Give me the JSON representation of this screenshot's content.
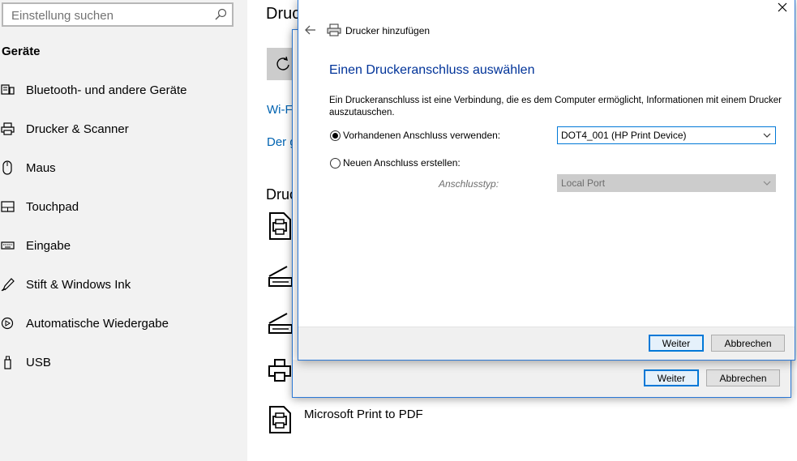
{
  "sidebar": {
    "search_placeholder": "Einstellung suchen",
    "heading": "Geräte",
    "items": [
      {
        "label": "Bluetooth- und andere Geräte",
        "icon": "bluetooth-devices-icon"
      },
      {
        "label": "Drucker & Scanner",
        "icon": "printer-icon"
      },
      {
        "label": "Maus",
        "icon": "mouse-icon"
      },
      {
        "label": "Touchpad",
        "icon": "touchpad-icon"
      },
      {
        "label": "Eingabe",
        "icon": "keyboard-icon"
      },
      {
        "label": "Stift & Windows Ink",
        "icon": "pen-icon"
      },
      {
        "label": "Automatische Wiedergabe",
        "icon": "autoplay-icon"
      },
      {
        "label": "USB",
        "icon": "usb-icon"
      }
    ]
  },
  "main": {
    "title": "Druc",
    "link1": "Wi-F",
    "link2": "Der g",
    "section_title": "Druc",
    "device_label": "Microsoft Print to PDF"
  },
  "back_dialog": {
    "next_label": "Weiter",
    "cancel_label": "Abbrechen"
  },
  "dialog": {
    "caption": "Drucker hinzufügen",
    "heading": "Einen Druckeranschluss auswählen",
    "description": "Ein Druckeranschluss ist eine Verbindung, die es dem Computer ermöglicht, Informationen mit einem Drucker auszutauschen.",
    "existing_port_label": "Vorhandenen Anschluss verwenden:",
    "existing_port_value": "DOT4_001 (HP Print Device)",
    "new_port_label": "Neuen Anschluss erstellen:",
    "port_type_label": "Anschlusstyp:",
    "port_type_value": "Local Port",
    "next_label": "Weiter",
    "cancel_label": "Abbrechen"
  },
  "colors": {
    "accent": "#0078d7",
    "heading_blue": "#003399",
    "link_blue": "#0063b1",
    "sidebar_bg": "#f2f2f2"
  }
}
